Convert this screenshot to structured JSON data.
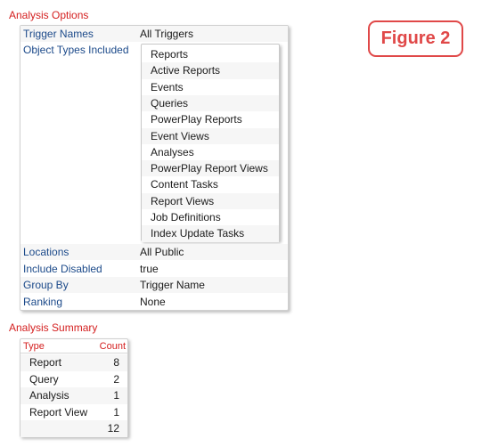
{
  "analysis_options": {
    "title": "Analysis Options",
    "rows_top": [
      {
        "label": "Trigger Names",
        "value": "All Triggers"
      },
      {
        "label": "Object Types Included",
        "value": ""
      }
    ],
    "object_types": [
      "Reports",
      "Active Reports",
      "Events",
      "Queries",
      "PowerPlay Reports",
      "Event Views",
      "Analyses",
      "PowerPlay Report Views",
      "Content Tasks",
      "Report Views",
      "Job Definitions",
      "Index Update Tasks"
    ],
    "rows_bottom": [
      {
        "label": "Locations",
        "value": "All Public"
      },
      {
        "label": "Include Disabled",
        "value": "true"
      },
      {
        "label": "Group By",
        "value": "Trigger Name"
      },
      {
        "label": "Ranking",
        "value": "None"
      }
    ]
  },
  "analysis_summary": {
    "title": "Analysis Summary",
    "columns": {
      "type": "Type",
      "count": "Count"
    },
    "rows": [
      {
        "type": "Report",
        "count": "8"
      },
      {
        "type": "Query",
        "count": "2"
      },
      {
        "type": "Analysis",
        "count": "1"
      },
      {
        "type": "Report View",
        "count": "1"
      }
    ],
    "total": "12"
  },
  "figure_label": "Figure 2",
  "colors": {
    "section_title": "#d42020",
    "label_text": "#1c4a8a",
    "badge": "#e04848"
  }
}
